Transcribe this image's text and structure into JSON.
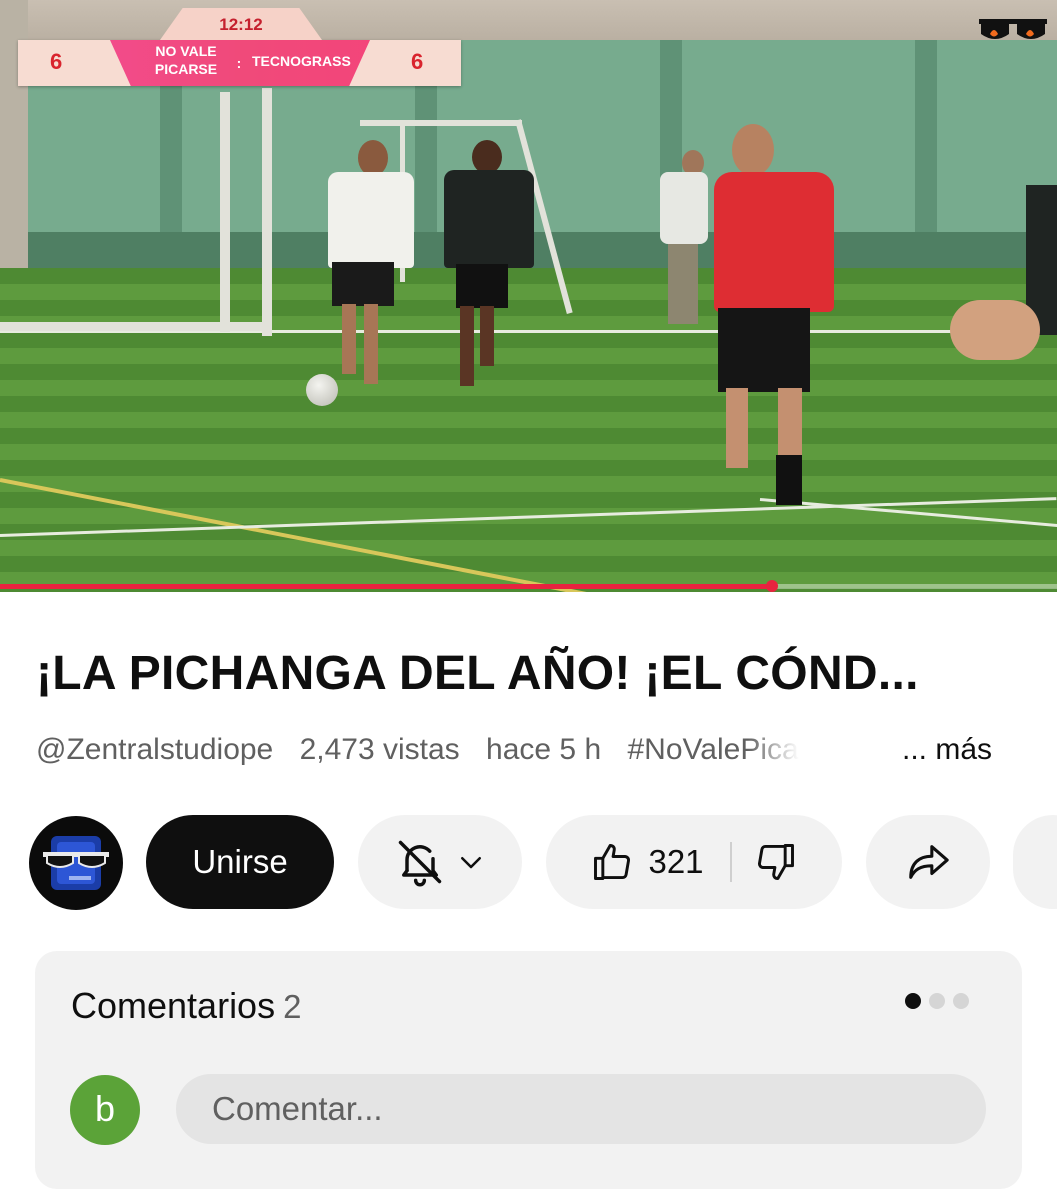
{
  "video": {
    "scoreboard": {
      "clock": "12:12",
      "home_score": "6",
      "home_team_line1": "NO VALE",
      "home_team_line2": "PICARSE",
      "separator": ":",
      "away_team": "TECNOGRASS",
      "away_score": "6"
    },
    "progress_fraction": 0.73,
    "colors": {
      "progress": "#e8233f",
      "scoreboard_band": "#f04a7a"
    }
  },
  "info": {
    "title": "¡LA PICHANGA DEL AÑO! ¡EL CÓND...",
    "channel": "@Zentralstudiope",
    "views": "2,473 vistas",
    "age": "hace 5 h",
    "hashtag": "#NoValePicarse",
    "more": "... más"
  },
  "actions": {
    "join_label": "Unirse",
    "like_count": "321",
    "icons": [
      "bell-icon",
      "chevron-down-icon",
      "thumb-up-icon",
      "thumb-down-icon",
      "share-icon"
    ]
  },
  "comments": {
    "title": "Comentarios",
    "count": "2",
    "user_initial": "b",
    "placeholder": "Comentar..."
  }
}
